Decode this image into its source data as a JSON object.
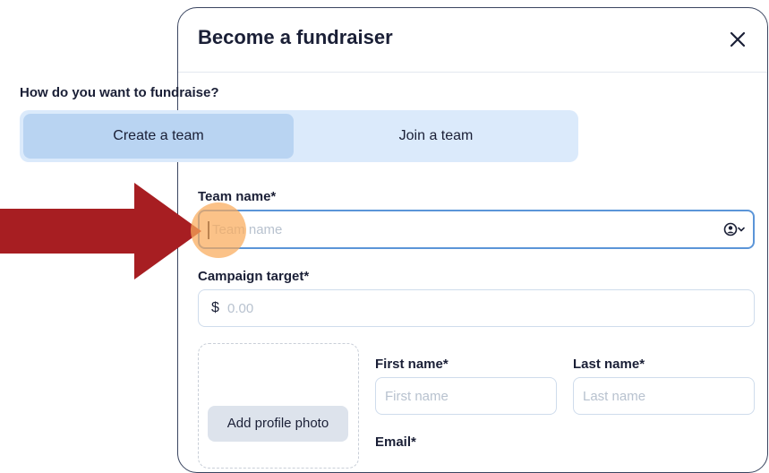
{
  "modal": {
    "title": "Become a fundraiser",
    "close_icon": "close-icon"
  },
  "fundraise_question": "How do you want to fundraise?",
  "segmented": {
    "options": [
      {
        "label": "Create a team",
        "selected": true
      },
      {
        "label": "Join a team",
        "selected": false
      }
    ]
  },
  "team_name": {
    "label": "Team name*",
    "placeholder": "Team name",
    "value": "",
    "icon": "user-circle-chevron-icon"
  },
  "campaign_target": {
    "label": "Campaign target*",
    "currency": "$",
    "placeholder": "0.00"
  },
  "profile_photo": {
    "button_label": "Add profile photo"
  },
  "first_name": {
    "label": "First name*",
    "placeholder": "First name"
  },
  "last_name": {
    "label": "Last name*",
    "placeholder": "Last name"
  },
  "email": {
    "label": "Email*"
  },
  "colors": {
    "arrow": "#a71e22",
    "segment_bg": "#dbeafb",
    "segment_active": "#b9d4f2",
    "focus_border": "#5b95d8",
    "click_marker": "#faaa5a"
  }
}
